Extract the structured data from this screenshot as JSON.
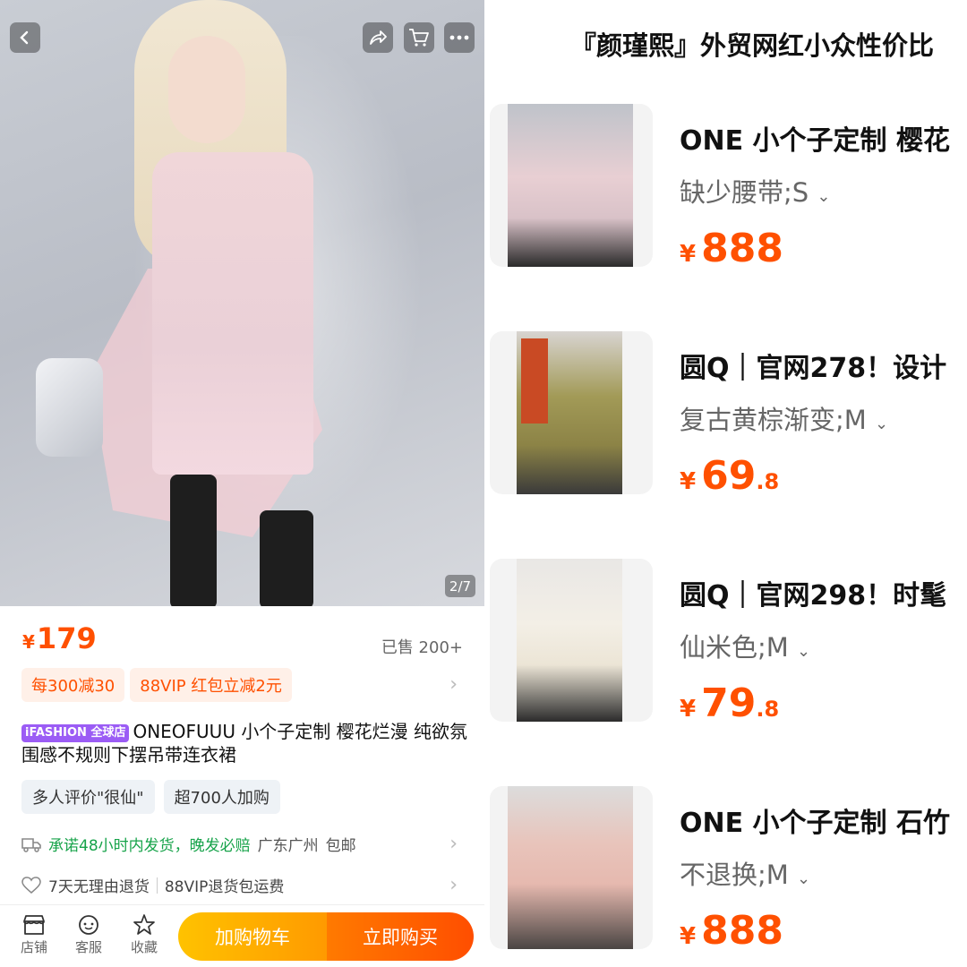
{
  "pager": "2/7",
  "price": {
    "currency": "¥",
    "value": "179"
  },
  "sold": "已售 200+",
  "promos": [
    "每300减30",
    "88VIP 红包立减2元"
  ],
  "store_badge": "iFASHION 全球店",
  "title": "ONEOFUUU 小个子定制 樱花烂漫 纯欲氛围感不规则下摆吊带连衣裙",
  "tags": [
    "多人评价\"很仙\"",
    "超700人加购"
  ],
  "shipping": {
    "promise": "承诺48小时内发货，晚发必赔",
    "location": "广东广州",
    "free": "包邮"
  },
  "service": {
    "return": "7天无理由退货",
    "vip": "88VIP退货包运费"
  },
  "bottom_bar": {
    "shop": "店铺",
    "service": "客服",
    "favorite": "收藏",
    "add_cart": "加购物车",
    "buy_now": "立即购买"
  },
  "store_title": "『颜瑾熙』外贸网红小众性价比",
  "items": [
    {
      "name": "ONE  小个子定制 樱花",
      "sku": "缺少腰带;S",
      "price_int": "888",
      "price_dec": ""
    },
    {
      "name": "圆Q｜官网278！设计",
      "sku": "复古黄棕渐变;M",
      "price_int": "69",
      "price_dec": ".8"
    },
    {
      "name": "圆Q｜官网298！时髦",
      "sku": "仙米色;M",
      "price_int": "79",
      "price_dec": ".8"
    },
    {
      "name": "ONE 小个子定制 石竹",
      "sku": "不退换;M",
      "price_int": "888",
      "price_dec": ""
    }
  ],
  "currency": "¥",
  "colors": {
    "accent": "#ff5000",
    "green": "#17a34a"
  }
}
